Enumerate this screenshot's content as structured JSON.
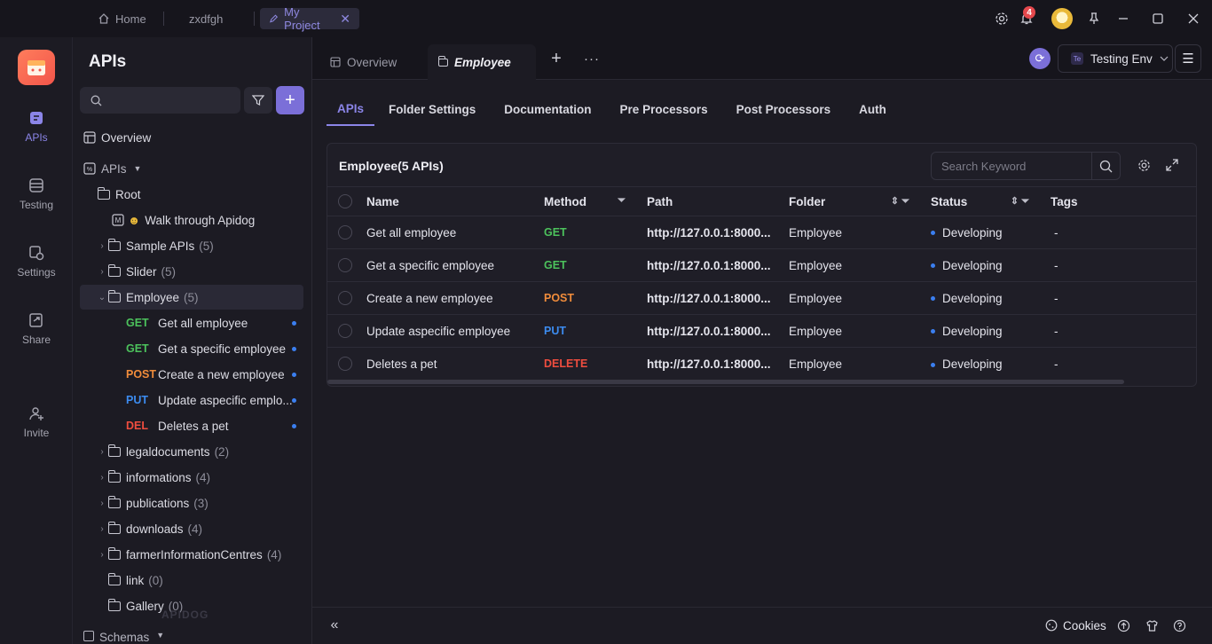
{
  "titlebar": {
    "tabs": [
      {
        "label": "Home"
      },
      {
        "label": "zxdfgh"
      },
      {
        "label": "My Project"
      }
    ],
    "notification_count": "4"
  },
  "rail": {
    "items": [
      {
        "label": "APIs",
        "icon": "apis-icon"
      },
      {
        "label": "Testing",
        "icon": "testing-icon"
      },
      {
        "label": "Settings",
        "icon": "settings-icon"
      },
      {
        "label": "Share",
        "icon": "share-icon"
      },
      {
        "label": "Invite",
        "icon": "invite-icon"
      }
    ]
  },
  "sidebar": {
    "title": "APIs",
    "overview": "Overview",
    "apis_label": "APIs",
    "root": "Root",
    "walkthrough": "Walk through Apidog",
    "folders_top": [
      {
        "name": "Sample APIs",
        "count": "(5)"
      },
      {
        "name": "Slider",
        "count": "(5)"
      },
      {
        "name": "Employee",
        "count": "(5)"
      }
    ],
    "endpoints": [
      {
        "method": "GET",
        "name": "Get all employee"
      },
      {
        "method": "GET",
        "name": "Get a specific employee"
      },
      {
        "method": "POST",
        "name": "Create a new employee"
      },
      {
        "method": "PUT",
        "name": "Update aspecific emplo..."
      },
      {
        "method": "DEL",
        "name": "Deletes a pet"
      }
    ],
    "folders_bottom": [
      {
        "name": "legaldocuments",
        "count": "(2)"
      },
      {
        "name": "informations",
        "count": "(4)"
      },
      {
        "name": "publications",
        "count": "(3)"
      },
      {
        "name": "downloads",
        "count": "(4)"
      },
      {
        "name": "farmerInformationCentres",
        "count": "(4)"
      },
      {
        "name": "link",
        "count": "(0)"
      },
      {
        "name": "Gallery",
        "count": "(0)"
      }
    ],
    "schemas": "Schemas",
    "watermark": "APIDOG"
  },
  "main": {
    "tabs": [
      {
        "label": "Overview"
      },
      {
        "label": "Employee"
      }
    ],
    "env": {
      "badge": "Te",
      "label": "Testing Env"
    },
    "subtabs": [
      "APIs",
      "Folder Settings",
      "Documentation",
      "Pre Processors",
      "Post Processors",
      "Auth"
    ],
    "panel_title": "Employee(5 APIs)",
    "search_placeholder": "Search Keyword",
    "columns": [
      "Name",
      "Method",
      "Path",
      "Folder",
      "Status",
      "Tags"
    ],
    "rows": [
      {
        "name": "Get all employee",
        "method": "GET",
        "path": "http://127.0.0.1:8000...",
        "folder": "Employee",
        "status": "Developing",
        "tags": "-"
      },
      {
        "name": "Get a specific employee",
        "method": "GET",
        "path": "http://127.0.0.1:8000...",
        "folder": "Employee",
        "status": "Developing",
        "tags": "-"
      },
      {
        "name": "Create a new employee",
        "method": "POST",
        "path": "http://127.0.0.1:8000...",
        "folder": "Employee",
        "status": "Developing",
        "tags": "-"
      },
      {
        "name": "Update aspecific employee",
        "method": "PUT",
        "path": "http://127.0.0.1:8000...",
        "folder": "Employee",
        "status": "Developing",
        "tags": "-"
      },
      {
        "name": "Deletes a pet",
        "method": "DELETE",
        "path": "http://127.0.0.1:8000...",
        "folder": "Employee",
        "status": "Developing",
        "tags": "-"
      }
    ],
    "footer": {
      "cookies": "Cookies"
    }
  },
  "colors": {
    "accent": "#8b85e8",
    "get": "#4cc25c",
    "post": "#f08c3b",
    "put": "#3c8cf0",
    "delete": "#ef4d3f"
  }
}
